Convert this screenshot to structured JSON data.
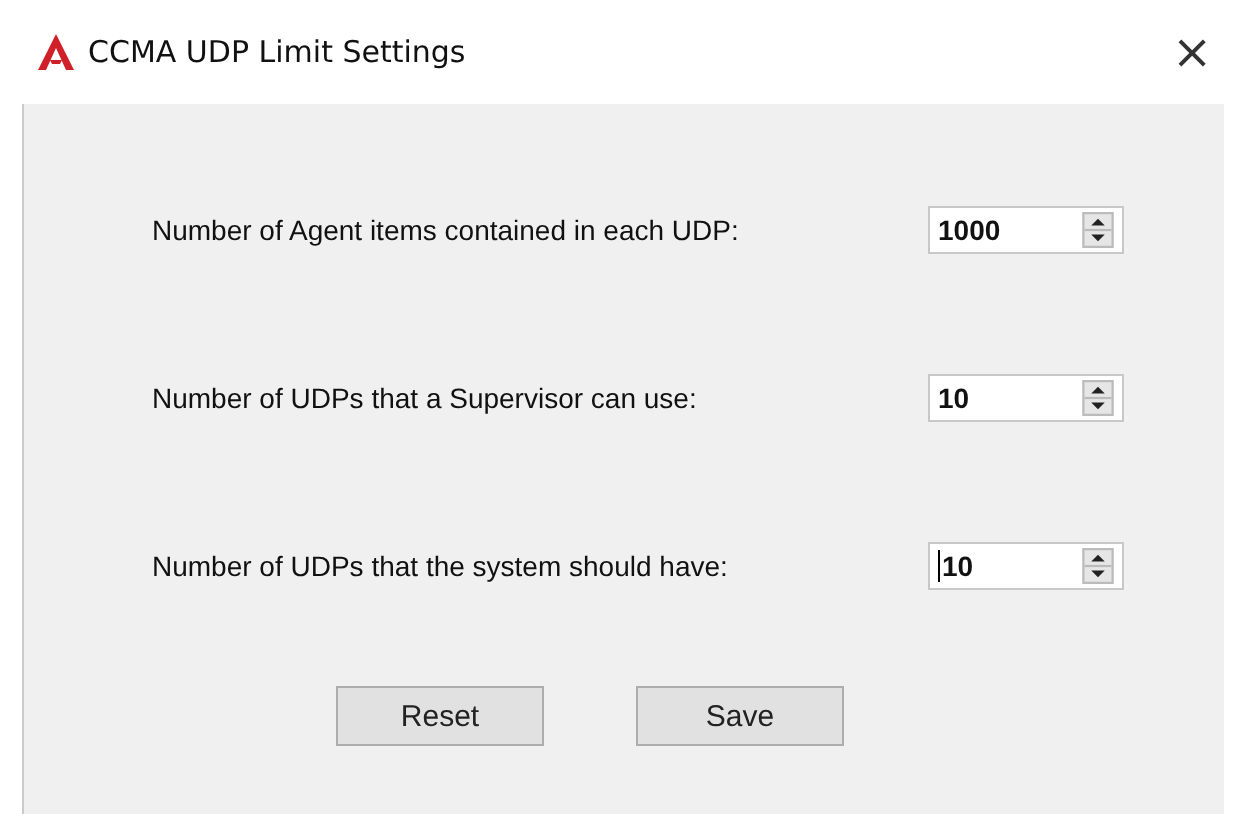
{
  "window": {
    "title": "CCMA UDP Limit Settings",
    "close": "×"
  },
  "settings": [
    {
      "label": "Number of Agent items contained in each UDP:",
      "value": "1000",
      "focused": false
    },
    {
      "label": "Number of UDPs that a Supervisor can use:",
      "value": "10",
      "focused": false
    },
    {
      "label": "Number of UDPs that the system should have:",
      "value": "10",
      "focused": true
    }
  ],
  "buttons": [
    "Reset",
    "Save"
  ]
}
